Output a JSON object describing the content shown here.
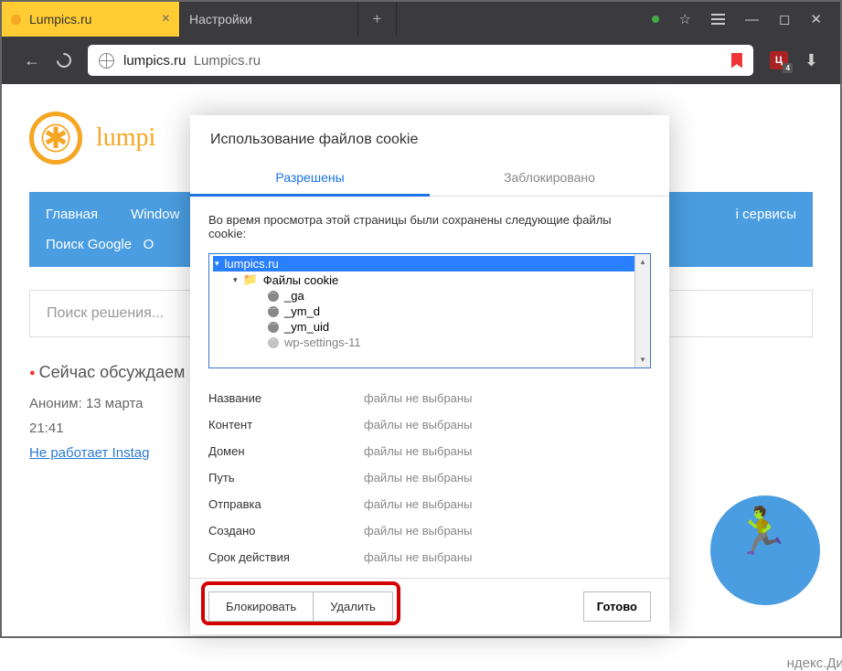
{
  "titlebar": {
    "tabs": [
      {
        "label": "Lumpics.ru",
        "active": true
      },
      {
        "label": "Настройки",
        "active": false
      }
    ]
  },
  "addressbar": {
    "domain": "lumpics.ru",
    "title": "Lumpics.ru",
    "ext_char": "Ц",
    "ext_count": "4"
  },
  "page": {
    "logo": "lumpi",
    "nav": [
      "Главная",
      "Window",
      "Поиск Google",
      "O",
      "i сервисы"
    ],
    "search_placeholder": "Поиск решения...",
    "widget_title": "Сейчас обсуждаем",
    "comment_meta": "Аноним: 13 марта",
    "comment_time": "21:41",
    "comment_link": "Не работает Instag",
    "yadisk": "ндекс.Диск"
  },
  "dialog": {
    "title": "Использование файлов cookie",
    "tab_allowed": "Разрешены",
    "tab_blocked": "Заблокировано",
    "description": "Во время просмотра этой страницы были сохранены следующие файлы cookie:",
    "tree": {
      "root": "lumpics.ru",
      "folder": "Файлы cookie",
      "items": [
        "_ga",
        "_ym_d",
        "_ym_uid",
        "wp-settings-11"
      ]
    },
    "details": [
      {
        "label": "Название",
        "value": "файлы не выбраны"
      },
      {
        "label": "Контент",
        "value": "файлы не выбраны"
      },
      {
        "label": "Домен",
        "value": "файлы не выбраны"
      },
      {
        "label": "Путь",
        "value": "файлы не выбраны"
      },
      {
        "label": "Отправка",
        "value": "файлы не выбраны"
      },
      {
        "label": "Создано",
        "value": "файлы не выбраны"
      },
      {
        "label": "Срок действия",
        "value": "файлы не выбраны"
      }
    ],
    "btn_block": "Блокировать",
    "btn_delete": "Удалить",
    "btn_done": "Готово"
  }
}
